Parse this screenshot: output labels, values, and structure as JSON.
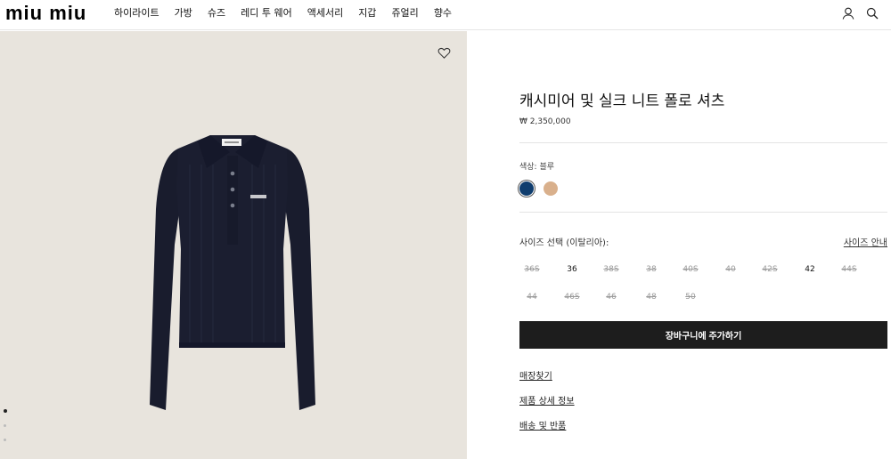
{
  "header": {
    "logo": "miu miu",
    "nav": [
      "하이라이트",
      "가방",
      "슈즈",
      "레디 투 웨어",
      "액세서리",
      "지갑",
      "쥬얼리",
      "향수"
    ],
    "icons": [
      "user-icon",
      "search-icon"
    ]
  },
  "gallery": {
    "bg_color": "#e8e4dd",
    "dots_total": 3,
    "dots_active": 1
  },
  "product": {
    "title": "캐시미어 및 실크 니트 폴로 셔츠",
    "price": "₩ 2,350,000",
    "color_label": "색상:",
    "color_value": "블루",
    "swatches": [
      {
        "name": "navy",
        "color": "#0f3d6e",
        "selected": true
      },
      {
        "name": "beige",
        "color": "#d9b08c",
        "selected": false
      }
    ],
    "size_label": "사이즈 선택 (이탈리아):",
    "size_guide": "사이즈 안내",
    "sizes_row1": [
      {
        "label": "36S",
        "available": false
      },
      {
        "label": "36",
        "available": true
      },
      {
        "label": "38S",
        "available": false
      },
      {
        "label": "38",
        "available": false
      },
      {
        "label": "40S",
        "available": false
      },
      {
        "label": "40",
        "available": false
      },
      {
        "label": "42S",
        "available": false
      },
      {
        "label": "42",
        "available": true
      },
      {
        "label": "44S",
        "available": false
      }
    ],
    "sizes_row2": [
      {
        "label": "44",
        "available": false
      },
      {
        "label": "46S",
        "available": false
      },
      {
        "label": "46",
        "available": false
      },
      {
        "label": "48",
        "available": false
      },
      {
        "label": "50",
        "available": false
      }
    ],
    "add_to_cart": "장바구니에 주가하기",
    "links": [
      "매장찾기",
      "제품 상세 정보",
      "배송 및 반품"
    ]
  }
}
